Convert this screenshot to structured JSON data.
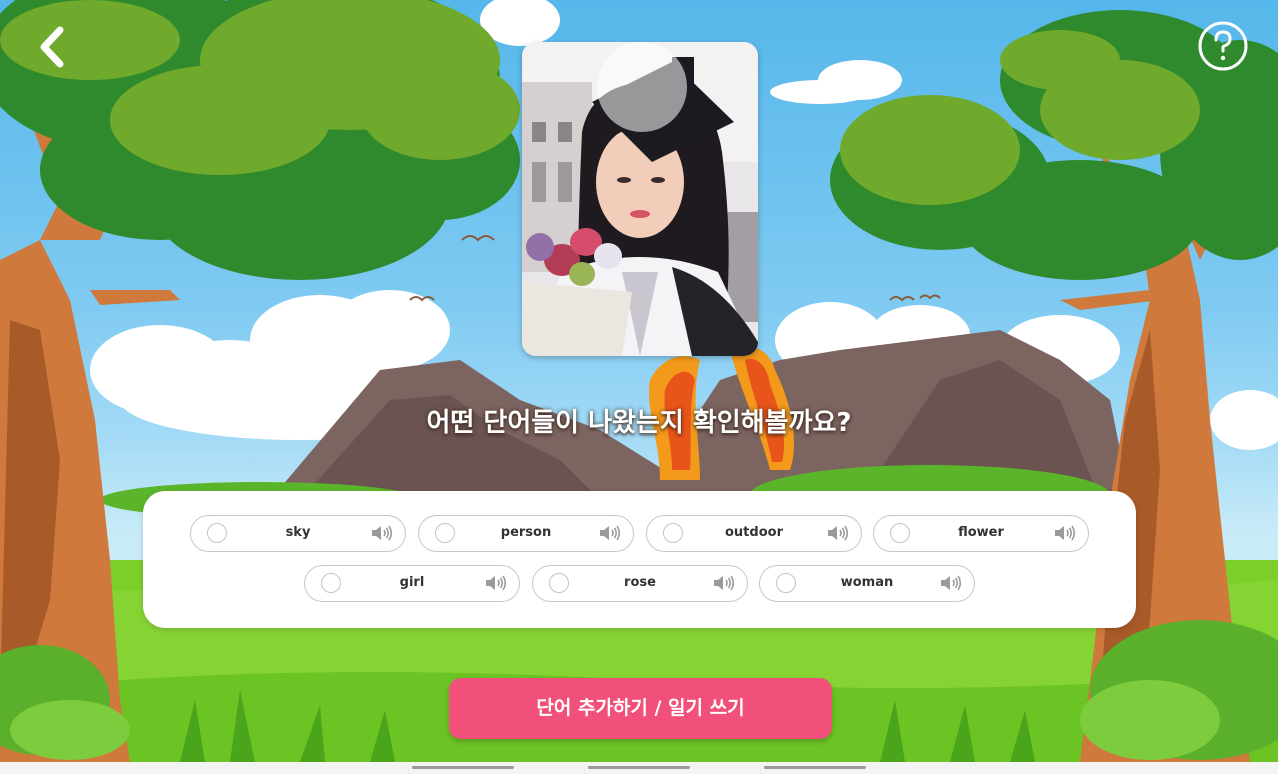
{
  "screen": {
    "question": "어떤 단어들이 나왔는지 확인해볼까요?",
    "photo_alt": "졸업 사진"
  },
  "words": [
    {
      "label": "sky"
    },
    {
      "label": "person"
    },
    {
      "label": "outdoor"
    },
    {
      "label": "flower"
    },
    {
      "label": "girl"
    },
    {
      "label": "rose"
    },
    {
      "label": "woman"
    }
  ],
  "cta": {
    "label": "단어 추가하기 / 일기 쓰기"
  },
  "icons": {
    "back": "chevron-left-icon",
    "help": "question-circle-icon",
    "speaker": "speaker-icon"
  },
  "colors": {
    "cta": "#f0507a",
    "sky": "#55b7ea",
    "grass": "#7ccf2a"
  }
}
